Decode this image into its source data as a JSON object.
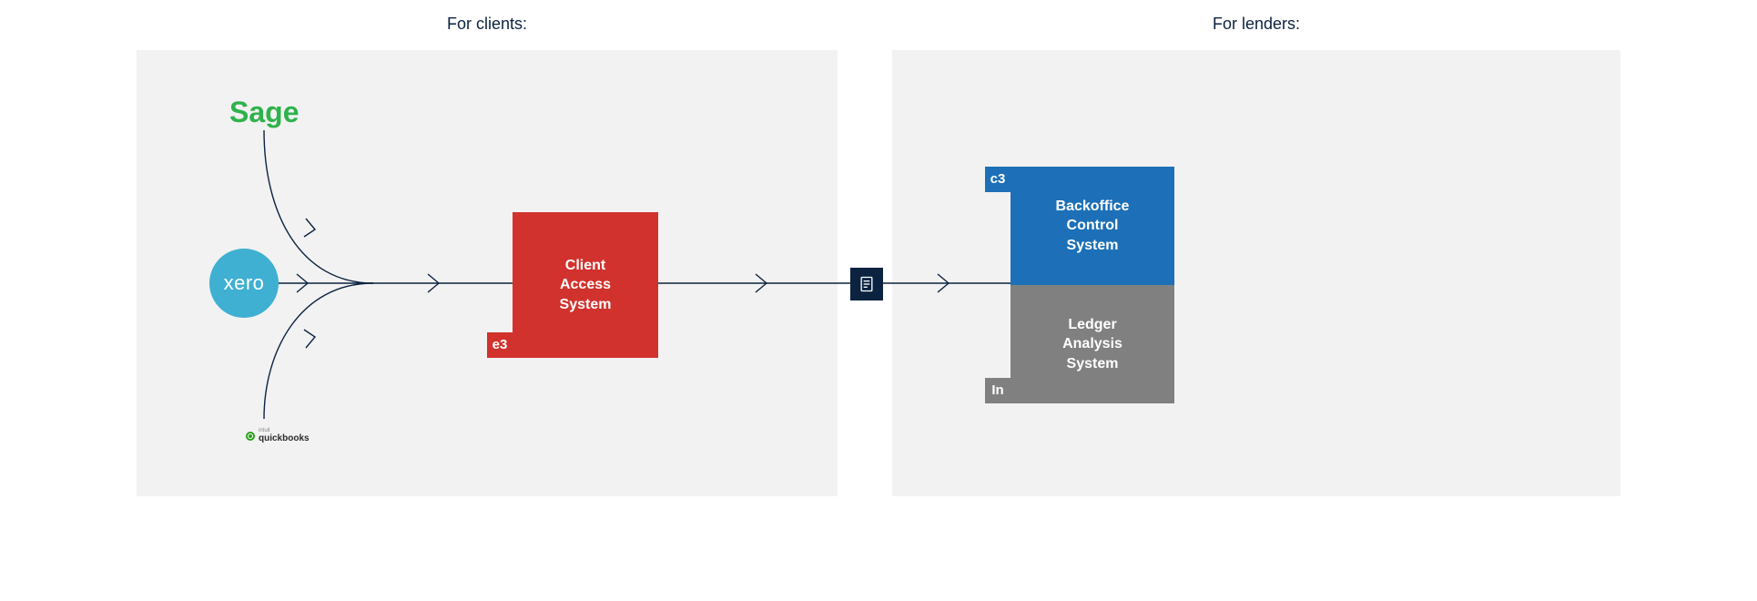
{
  "headings": {
    "clients": "For clients:",
    "lenders": "For lenders:"
  },
  "sources": {
    "sage": {
      "label": "Sage"
    },
    "xero": {
      "label": "xero"
    },
    "qb": {
      "brand": "intuit",
      "label": "quickbooks"
    }
  },
  "client_system": {
    "tag": "e3",
    "title_line1": "Client",
    "title_line2": "Access",
    "title_line3": "System"
  },
  "lender_systems": {
    "c3": {
      "tag": "c3",
      "title_line1": "Backoffice",
      "title_line2": "Control",
      "title_line3": "System"
    },
    "in": {
      "tag": "In",
      "title_line1": "Ledger",
      "title_line2": "Analysis",
      "title_line3": "System"
    }
  },
  "icons": {
    "document": "document-icon"
  },
  "colors": {
    "accent_navy": "#0b2340",
    "client_red": "#d1322d",
    "lender_blue": "#1d70b7",
    "lender_grey": "#808080",
    "panel_bg": "#f2f2f2",
    "xero_blue": "#3fb0d2",
    "sage_green": "#2fb24c",
    "qb_green": "#2ca01c"
  }
}
